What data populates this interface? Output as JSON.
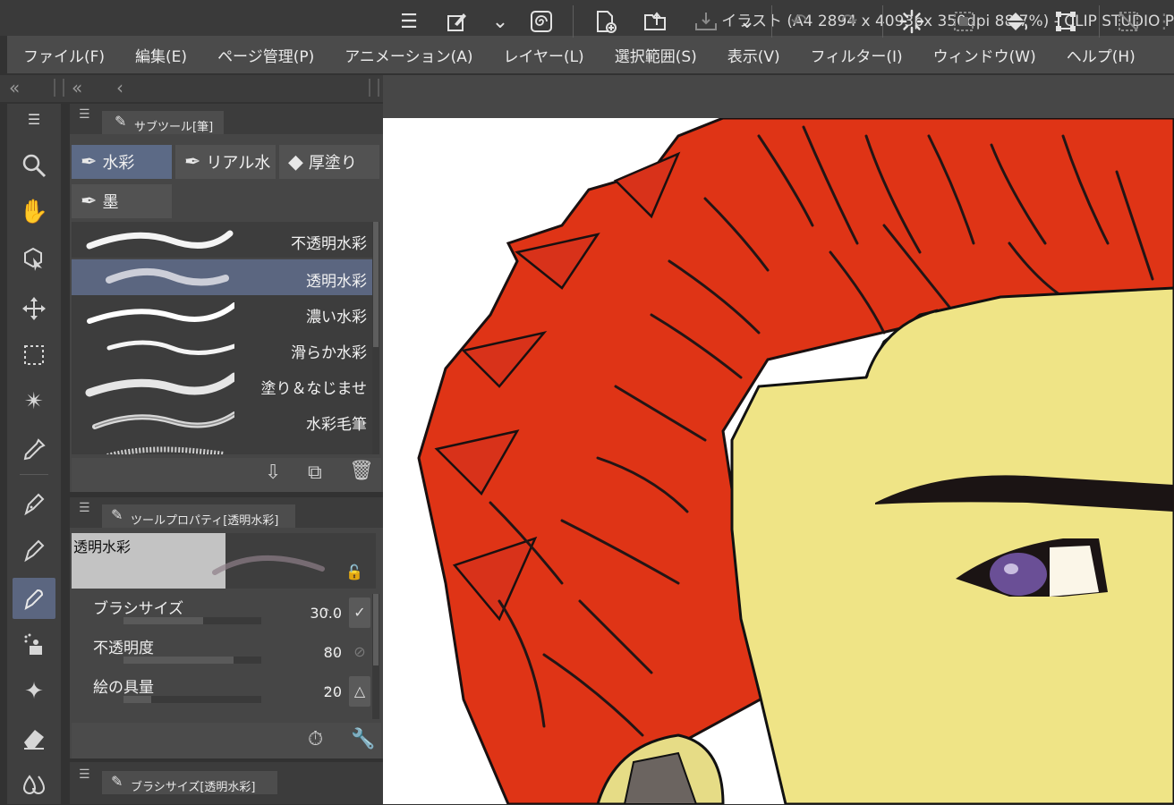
{
  "window": {
    "title": "イラスト (A4 2894 x 4093px 350dpi 88.7%)  - CLIP STUDIO P"
  },
  "menu": [
    "ファイル(F)",
    "編集(E)",
    "ページ管理(P)",
    "アニメーション(A)",
    "レイヤー(L)",
    "選択範囲(S)",
    "表示(V)",
    "フィルター(I)",
    "ウィンドウ(W)",
    "ヘルプ(H)"
  ],
  "subtool": {
    "title": "サブツール[筆]",
    "groups": [
      {
        "label": "水彩",
        "selected": true
      },
      {
        "label": "リアル水",
        "selected": false
      },
      {
        "label": "厚塗り",
        "selected": false
      },
      {
        "label": "墨",
        "selected": false
      }
    ],
    "brushes": [
      {
        "label": "不透明水彩",
        "selected": false
      },
      {
        "label": "透明水彩",
        "selected": true
      },
      {
        "label": "濃い水彩",
        "selected": false
      },
      {
        "label": "滑らか水彩",
        "selected": false
      },
      {
        "label": "塗り＆なじませ",
        "selected": false
      },
      {
        "label": "水彩毛筆",
        "selected": false
      }
    ]
  },
  "property": {
    "title": "ツールプロパティ[透明水彩]",
    "preview_label": "透明水彩",
    "rows": [
      {
        "label": "ブラシサイズ",
        "value": "30.0",
        "fill": 0.58
      },
      {
        "label": "不透明度",
        "value": "80",
        "fill": 0.8
      },
      {
        "label": "絵の具量",
        "value": "20",
        "fill": 0.2
      }
    ]
  },
  "brushsize_panel": {
    "title": "ブラシサイズ[透明水彩]"
  },
  "colors": {
    "accent": "#5b6680",
    "hair": "#e03418",
    "skin": "#efe486"
  }
}
